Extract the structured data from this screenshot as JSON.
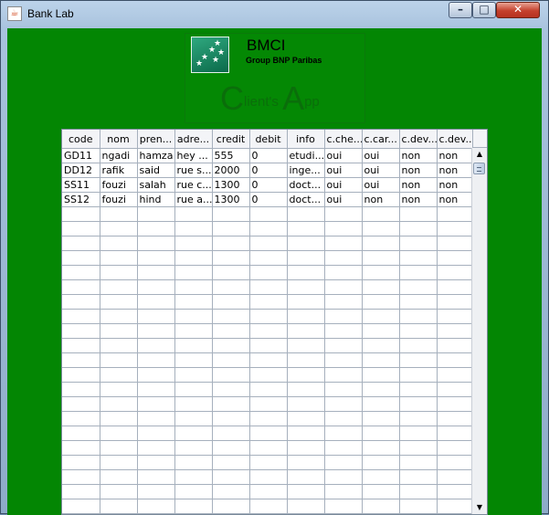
{
  "window": {
    "title": "Bank Lab",
    "app_icon": "java-cup-icon"
  },
  "logo": {
    "name": "BMCI",
    "subtitle": "Group BNP Paribas",
    "app_title_parts": [
      "C",
      "lient's ",
      "A",
      "pp"
    ]
  },
  "table": {
    "columns": [
      "code",
      "nom",
      "pren...",
      "adre...",
      "credit",
      "debit",
      "info",
      "c.che...",
      "c.car...",
      "c.dev...",
      "c.dev..."
    ],
    "rows": [
      [
        "GD11",
        "ngadi",
        "hamza",
        "hey ...",
        "555",
        "0",
        "etudi...",
        "oui",
        "oui",
        "non",
        "non"
      ],
      [
        "DD12",
        "rafik",
        "said",
        "rue s...",
        "2000",
        "0",
        "inge...",
        "oui",
        "oui",
        "non",
        "non"
      ],
      [
        "SS11",
        "fouzi",
        "salah",
        "rue c...",
        "1300",
        "0",
        "doct...",
        "oui",
        "oui",
        "non",
        "non"
      ],
      [
        "SS12",
        "fouzi",
        "hind",
        "rue a...",
        "1300",
        "0",
        "doct...",
        "oui",
        "non",
        "non",
        "non"
      ]
    ],
    "empty_rows": 21
  },
  "colors": {
    "background_green": "#038603",
    "logo_teal": "#0b6a4a"
  }
}
